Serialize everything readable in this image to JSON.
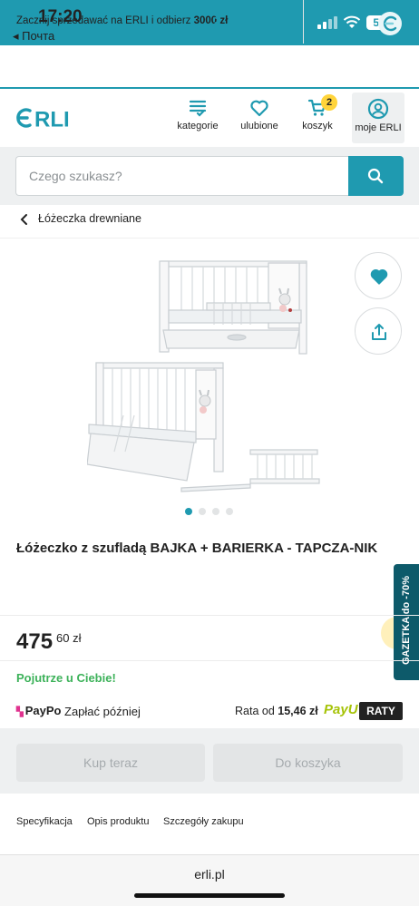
{
  "status_bar": {
    "time": "17:20",
    "back_label": "◂ Почта",
    "battery": "52"
  },
  "promo": {
    "text": "Zacznij sprzedawać na ERLI i odbierz ",
    "amount": "3000 zł",
    "arrow": ">"
  },
  "header": {
    "logo": "ERLI",
    "nav": [
      {
        "label": "kategorie",
        "icon": "list-icon"
      },
      {
        "label": "ulubione",
        "icon": "heart-icon"
      },
      {
        "label": "koszyk",
        "icon": "cart-icon"
      },
      {
        "label": "moje ERLI",
        "icon": "user-icon"
      }
    ],
    "cart_count": "2"
  },
  "search": {
    "placeholder": "Czego szukasz?"
  },
  "breadcrumb": {
    "label": "Łóżeczka drewniane"
  },
  "gallery": {
    "image_count": 4,
    "active_index": 0
  },
  "product": {
    "title": "Łóżeczko z szufladą BAJKA + BARIERKA - TAPCZA-NIK",
    "price_main": "475",
    "price_fraction": "60 zł",
    "delivery": "Pojutrze u Ciebie!"
  },
  "payment": {
    "paypo_logo": "PayPo",
    "paypo_text": "Zapłać później",
    "raty_prefix": "Rata od ",
    "raty_amount": "15,46 zł",
    "payu_logo": "PayU",
    "raty_badge": "RATY"
  },
  "actions": {
    "buy_now": "Kup teraz",
    "add_to_cart": "Do koszyka"
  },
  "side_tab": {
    "label": "GAZETKA do -70%"
  },
  "tabs": [
    "Specyfikacja",
    "Opis produktu",
    "Szczegóły zakupu"
  ],
  "browser": {
    "url": "erli.pl"
  },
  "colors": {
    "brand": "#1f9ab0",
    "delivery_green": "#3db25a",
    "badge_yellow": "#ffd43b",
    "side_tab": "#0d5a6a"
  }
}
